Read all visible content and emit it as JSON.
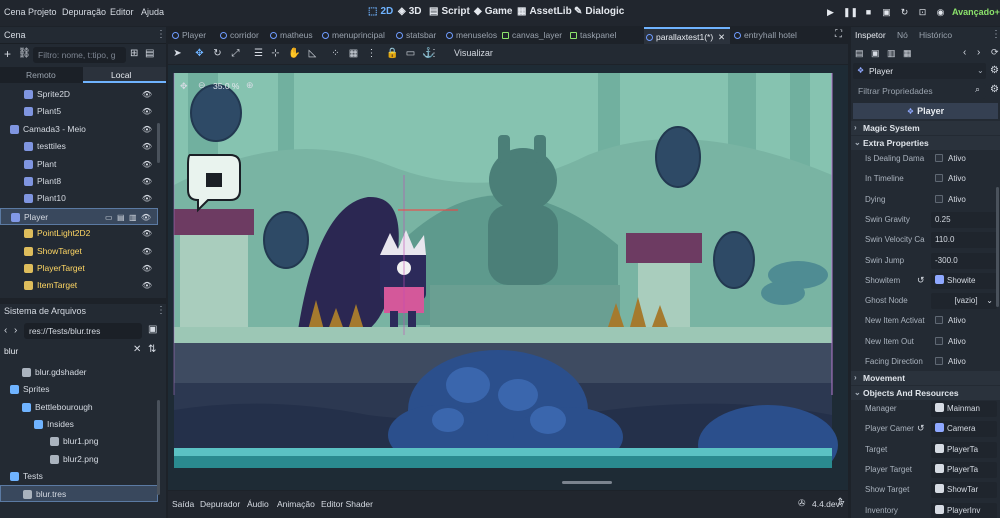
{
  "menubar": {
    "menus": [
      "Cena",
      "Projeto",
      "Depuração",
      "Editor",
      "Ajuda"
    ],
    "workspaces": [
      {
        "label": "2D",
        "icon": "2d-icon",
        "active": true
      },
      {
        "label": "3D",
        "icon": "3d-icon",
        "active": false
      },
      {
        "label": "Script",
        "icon": "script-icon",
        "active": false
      },
      {
        "label": "Game",
        "icon": "game-icon",
        "active": false
      },
      {
        "label": "AssetLib",
        "icon": "assetlib-icon",
        "active": false
      },
      {
        "label": "Dialogic",
        "icon": "dialogic-icon",
        "active": false
      }
    ],
    "renderer": "Avançado+"
  },
  "scene_dock": {
    "title": "Cena",
    "filter_placeholder": "Filtro: nome, t:tipo, g",
    "tabs": [
      "Remoto",
      "Local"
    ],
    "active_tab": "Local",
    "tree": [
      {
        "label": "Sprite2D",
        "icon": "sprite-icon",
        "color": "#8fa8ff"
      },
      {
        "label": "Plant5",
        "icon": "sprite-icon",
        "color": "#8fa8ff"
      },
      {
        "label": "Camada3 - Meio",
        "icon": "parallax-icon",
        "color": "#8fa8ff"
      },
      {
        "label": "testtiles",
        "icon": "tilemap-icon",
        "color": "#8fa8ff"
      },
      {
        "label": "Plant",
        "icon": "sprite-icon",
        "color": "#8fa8ff"
      },
      {
        "label": "Plant8",
        "icon": "sprite-icon",
        "color": "#8fa8ff"
      },
      {
        "label": "Plant10",
        "icon": "sprite-icon",
        "color": "#8fa8ff"
      },
      {
        "label": "Player",
        "icon": "character-icon",
        "color": "#8fa8ff",
        "selected": true
      },
      {
        "label": "PointLight2D2",
        "icon": "light-icon",
        "color": "#ffd764"
      },
      {
        "label": "ShowTarget",
        "icon": "marker-icon",
        "color": "#ffd764"
      },
      {
        "label": "PlayerTarget",
        "icon": "marker-icon",
        "color": "#ffd764"
      },
      {
        "label": "ItemTarget",
        "icon": "marker-icon",
        "color": "#ffd764"
      }
    ]
  },
  "fs_dock": {
    "title": "Sistema de Arquivos",
    "path": "res://Tests/blur.tres",
    "search_value": "blur",
    "tree": [
      {
        "label": "blur.gdshader",
        "kind": "file"
      },
      {
        "label": "Sprites",
        "kind": "folder"
      },
      {
        "label": "Bettlebourough",
        "kind": "folder"
      },
      {
        "label": "Insides",
        "kind": "folder"
      },
      {
        "label": "blur1.png",
        "kind": "file"
      },
      {
        "label": "blur2.png",
        "kind": "file"
      },
      {
        "label": "Tests",
        "kind": "folder"
      },
      {
        "label": "blur.tres",
        "kind": "file",
        "selected": true
      }
    ]
  },
  "main_tabs": [
    {
      "label": "Player",
      "kind": "scene"
    },
    {
      "label": "corridor",
      "kind": "scene"
    },
    {
      "label": "matheus",
      "kind": "scene"
    },
    {
      "label": "menuprincipal",
      "kind": "scene"
    },
    {
      "label": "statsbar",
      "kind": "scene"
    },
    {
      "label": "menuselos",
      "kind": "scene"
    },
    {
      "label": "canvas_layer",
      "kind": "ui"
    },
    {
      "label": "taskpanel",
      "kind": "ui"
    },
    {
      "label": "parallaxtest1(*)",
      "kind": "scene",
      "active": true
    },
    {
      "label": "entryhall hotel",
      "kind": "scene"
    }
  ],
  "toolbar": {
    "view_label": "Visualizar"
  },
  "viewport": {
    "zoom": "35.0 %"
  },
  "bottom_bar": {
    "tabs": [
      "Saída",
      "Depurador",
      "Áudio",
      "Animação",
      "Editor Shader"
    ],
    "version": "4.4.dev7"
  },
  "inspector": {
    "tabs": [
      "Inspetor",
      "Nó",
      "Histórico"
    ],
    "active_tab": "Inspetor",
    "node_selector": "Player",
    "filter_placeholder": "Filtrar Propriedades",
    "header": "Player",
    "sections": [
      {
        "label": "Magic System",
        "expanded": false
      },
      {
        "label": "Extra Properties",
        "expanded": true
      },
      {
        "label": "Movement",
        "expanded": false
      },
      {
        "label": "Objects And Resources",
        "expanded": true
      }
    ],
    "extra_properties": [
      {
        "name": "Is Dealing Dama",
        "value": "Ativo",
        "kind": "check"
      },
      {
        "name": "In Timeline",
        "value": "Ativo",
        "kind": "check"
      },
      {
        "name": "Dying",
        "value": "Ativo",
        "kind": "check"
      },
      {
        "name": "Swin Gravity",
        "value": "0.25",
        "kind": "number"
      },
      {
        "name": "Swin Velocity Ca",
        "value": "110.0",
        "kind": "number"
      },
      {
        "name": "Swin Jump",
        "value": "-300.0",
        "kind": "number"
      },
      {
        "name": "Showitem",
        "value": "Showite",
        "kind": "resource"
      },
      {
        "name": "Ghost Node",
        "value": "[vazio]",
        "kind": "dropdown"
      },
      {
        "name": "New Item Activat",
        "value": "Ativo",
        "kind": "check"
      },
      {
        "name": "New Item Out",
        "value": "Ativo",
        "kind": "check"
      },
      {
        "name": "Facing Direction",
        "value": "Ativo",
        "kind": "check"
      }
    ],
    "object_properties": [
      {
        "name": "Manager",
        "value": "Mainman",
        "kind": "resource"
      },
      {
        "name": "Player Camer",
        "value": "Camera",
        "kind": "resource"
      },
      {
        "name": "Target",
        "value": "PlayerTa",
        "kind": "resource"
      },
      {
        "name": "Player Target",
        "value": "PlayerTa",
        "kind": "resource"
      },
      {
        "name": "Show Target",
        "value": "ShowTar",
        "kind": "resource"
      },
      {
        "name": "Inventory",
        "value": "PlayerInv",
        "kind": "resource"
      }
    ]
  },
  "colors": {
    "accent": "#6fb3ff",
    "renderer": "#8be26b",
    "node_yellow": "#ffd764",
    "node_blue": "#8fa8ff"
  }
}
